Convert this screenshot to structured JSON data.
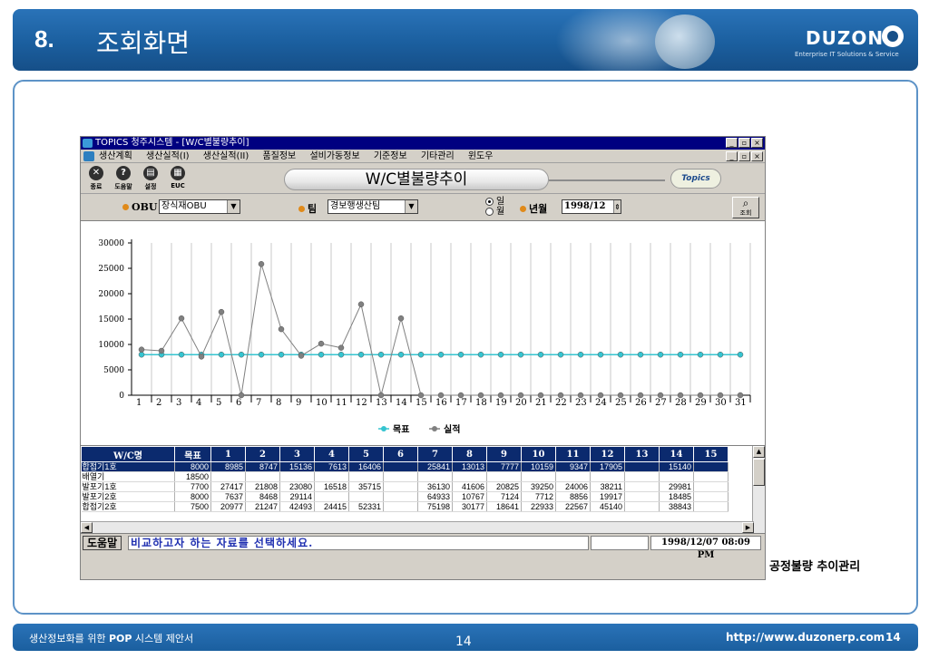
{
  "slide": {
    "number": "8.",
    "title": "조회화면",
    "logo": "DUZON",
    "logo_sub": "Enterprise IT Solutions & Service",
    "side_caption": "공정불량 추이관리",
    "footer_left_pre": "생산정보화를 위한 ",
    "footer_left_bold": "POP",
    "footer_left_post": " 시스템 제안서",
    "footer_page": "14",
    "footer_url": "http://www.duzonerp.com",
    "footer_page_right": "14"
  },
  "window": {
    "title": "TOPICS 청주시스템 - [W/C별불량추이]",
    "menus": [
      "생산계획",
      "생산실적(I)",
      "생산실적(II)",
      "품질정보",
      "설비가동정보",
      "기준정보",
      "기타관리",
      "윈도우"
    ],
    "winbtns": [
      "_",
      "▫",
      "×"
    ]
  },
  "toolbar": {
    "buttons": [
      {
        "icon": "✕",
        "label": "종료"
      },
      {
        "icon": "?",
        "label": "도움말"
      },
      {
        "icon": "▤",
        "label": "설정"
      },
      {
        "icon": "▦",
        "label": "EUC"
      }
    ],
    "screen_title": "W/C별불량추이",
    "brand": "Topics"
  },
  "filters": {
    "obu_label": "OBU",
    "obu_value": "장식재OBU",
    "team_label": "팀",
    "team_value": "경보행생산팀",
    "radio_day": "일",
    "radio_month": "월",
    "ym_label": "년월",
    "ym_value": "1998/12",
    "search_label": "조회"
  },
  "chart_data": {
    "type": "line",
    "x": [
      1,
      2,
      3,
      4,
      5,
      6,
      7,
      8,
      9,
      10,
      11,
      12,
      13,
      14,
      15,
      16,
      17,
      18,
      19,
      20,
      21,
      22,
      23,
      24,
      25,
      26,
      27,
      28,
      29,
      30,
      31
    ],
    "ylim": [
      0,
      30000
    ],
    "yticks": [
      0,
      5000,
      10000,
      15000,
      20000,
      25000,
      30000
    ],
    "grid": true,
    "legend_position": "bottom",
    "series": [
      {
        "name": "목표",
        "color": "#35c4d0",
        "values": [
          8000,
          8000,
          8000,
          8000,
          8000,
          8000,
          8000,
          8000,
          8000,
          8000,
          8000,
          8000,
          8000,
          8000,
          8000,
          8000,
          8000,
          8000,
          8000,
          8000,
          8000,
          8000,
          8000,
          8000,
          8000,
          8000,
          8000,
          8000,
          8000,
          8000,
          8000
        ]
      },
      {
        "name": "실적",
        "color": "#808080",
        "values": [
          8985,
          8747,
          15136,
          7613,
          16406,
          0,
          25841,
          13013,
          7777,
          10159,
          9347,
          17905,
          0,
          15140,
          0,
          0,
          0,
          0,
          0,
          0,
          0,
          0,
          0,
          0,
          0,
          0,
          0,
          0,
          0,
          0,
          0
        ]
      }
    ]
  },
  "grid": {
    "headers": [
      "W/C명",
      "목표",
      "1",
      "2",
      "3",
      "4",
      "5",
      "6",
      "7",
      "8",
      "9",
      "10",
      "11",
      "12",
      "13",
      "14",
      "15"
    ],
    "rows": [
      [
        "합접기1호",
        "8000",
        "8985",
        "8747",
        "15136",
        "7613",
        "16406",
        "",
        "25841",
        "13013",
        "7777",
        "10159",
        "9347",
        "17905",
        "",
        "15140",
        ""
      ],
      [
        "배열기",
        "18500",
        "",
        "",
        "",
        "",
        "",
        "",
        "",
        "",
        "",
        "",
        "",
        "",
        "",
        "",
        ""
      ],
      [
        "발포기1호",
        "7700",
        "27417",
        "21808",
        "23080",
        "16518",
        "35715",
        "",
        "36130",
        "41606",
        "20825",
        "39250",
        "24006",
        "38211",
        "",
        "29981",
        ""
      ],
      [
        "발포기2호",
        "8000",
        "7637",
        "8468",
        "29114",
        "",
        "",
        "",
        "64933",
        "10767",
        "7124",
        "7712",
        "8856",
        "19917",
        "",
        "18485",
        ""
      ],
      [
        "합접기2호",
        "7500",
        "20977",
        "21247",
        "42493",
        "24415",
        "52331",
        "",
        "75198",
        "30177",
        "18641",
        "22933",
        "22567",
        "45140",
        "",
        "38843",
        ""
      ]
    ]
  },
  "status": {
    "help": "도움말",
    "message": "비교하고자 하는 자료를 선택하세요.",
    "datetime": "1998/12/07 08:09 PM"
  }
}
